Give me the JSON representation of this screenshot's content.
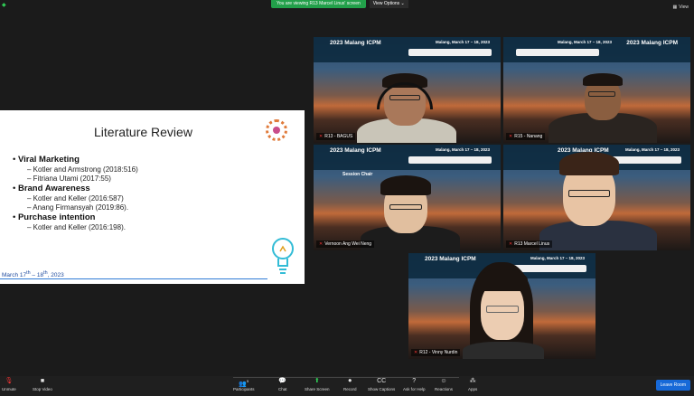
{
  "banner": {
    "viewing": "You are viewing R13 Marcel Linus' screen",
    "view_options": "View Options",
    "view_right": "View"
  },
  "slide": {
    "title": "Literature Review",
    "sections": [
      {
        "heading": "Viral Marketing",
        "items": [
          "Kotler and Armstrong (2018:516)",
          "Fitriana Utami (2017:55)"
        ]
      },
      {
        "heading": "Brand Awareness",
        "items": [
          "Kotler and Keller (2016:587)",
          "Anang Firmansyah (2019:86)."
        ]
      },
      {
        "heading": "Purchase intention",
        "items": [
          "Kotler and Keller (2016:198)."
        ]
      }
    ],
    "date_prefix": "March 17",
    "date_sup1": "th",
    "date_mid": " – 18",
    "date_sup2": "th",
    "date_suffix": ", 2023"
  },
  "tiles": [
    {
      "name": "R13 - BAGUS",
      "title": "2023 Malang ICPM",
      "date": "Malang, March 17 – 18, 2023"
    },
    {
      "name": "R15 - Nanang",
      "title": "2023 Malang ICPM",
      "date": "Malang, March 17 – 18, 2023"
    },
    {
      "name": "Vernoon Ang Wei Neng",
      "title": "2023 Malang ICPM",
      "date": "Malang, March 17 – 18, 2023",
      "extra": "Session Chair"
    },
    {
      "name": "R13 Marcel Linus",
      "title": "2023 Malang ICPM",
      "date": "Malang, March 17 – 18, 2023"
    },
    {
      "name": "R12 - Vinny Nurdin",
      "title": "2023 Malang ICPM",
      "date": "Malang, March 17 – 18, 2023"
    }
  ],
  "toolbar": {
    "unmute": "Unmute",
    "stop_video": "Stop Video",
    "participants": "Participants",
    "participants_count": "5",
    "chat": "Chat",
    "share": "Share Screen",
    "record": "Record",
    "captions": "Show Captions",
    "help": "Ask for Help",
    "reactions": "Reactions",
    "apps": "Apps",
    "leave": "Leave Room"
  },
  "colors": {
    "viewing_bg": "#22a04a",
    "leave_bg": "#1769d8",
    "active_outline": "#e8e000"
  }
}
